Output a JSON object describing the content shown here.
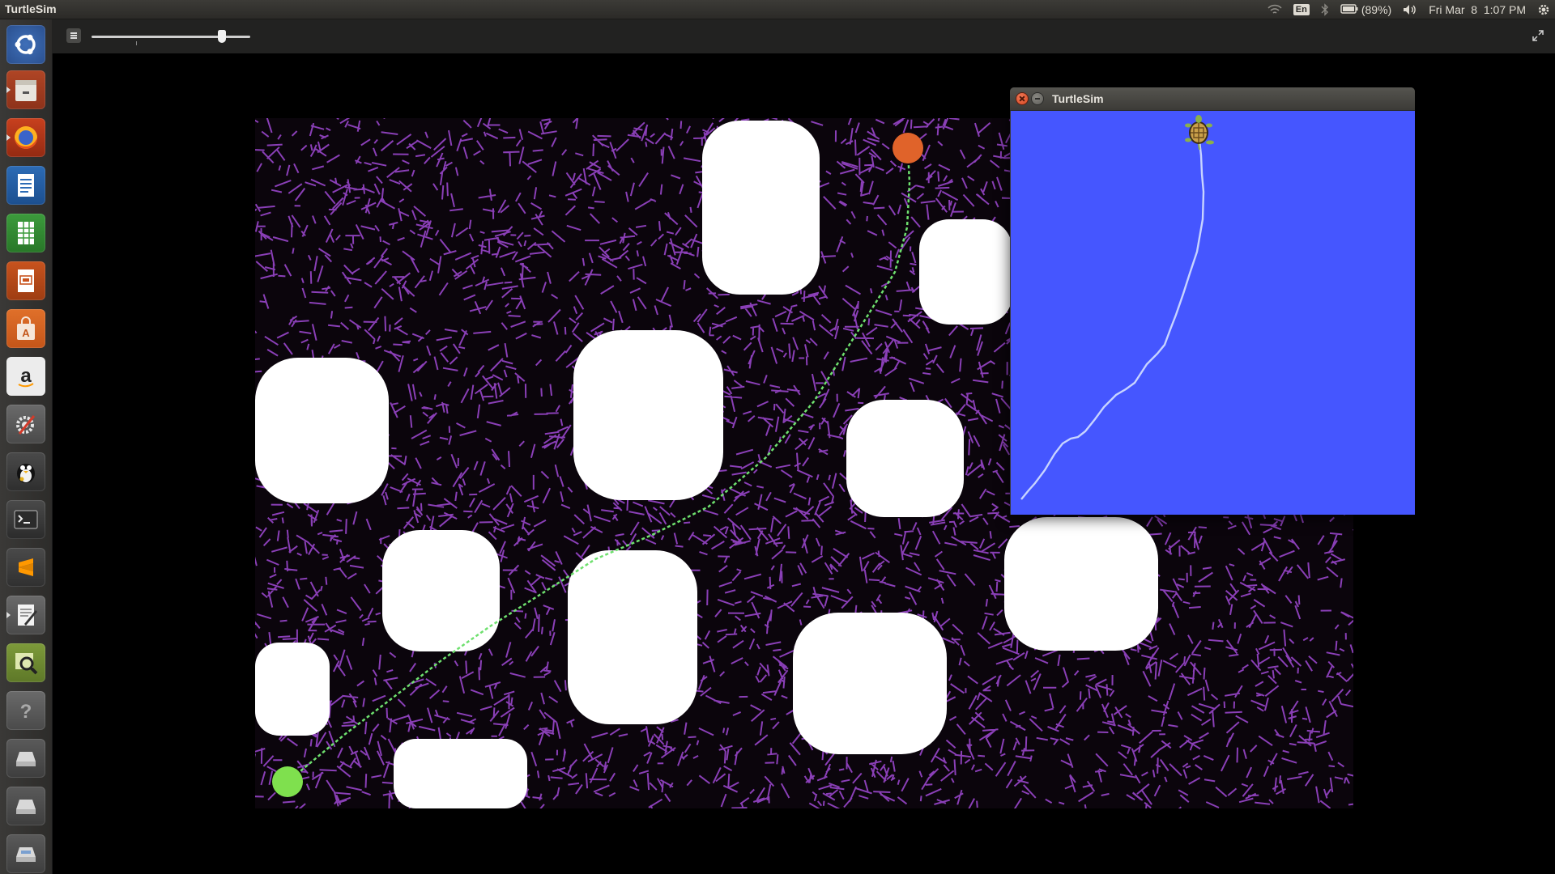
{
  "top_panel": {
    "app_title": "TurtleSim",
    "language": "En",
    "battery": "(89%)",
    "datetime": "Fri Mar  8  1:07 PM"
  },
  "launcher": {
    "items": [
      {
        "name": "dash",
        "icon": "ubuntu-logo-icon"
      },
      {
        "name": "files",
        "icon": "file-cabinet-icon"
      },
      {
        "name": "firefox",
        "icon": "firefox-icon"
      },
      {
        "name": "writer",
        "icon": "document-icon"
      },
      {
        "name": "calc",
        "icon": "spreadsheet-icon"
      },
      {
        "name": "impress",
        "icon": "presentation-icon"
      },
      {
        "name": "software-center",
        "icon": "shopping-bag-icon"
      },
      {
        "name": "amazon",
        "icon": "amazon-icon"
      },
      {
        "name": "system-settings",
        "icon": "wrench-gear-icon"
      },
      {
        "name": "gnome-ppp",
        "icon": "penguin-icon"
      },
      {
        "name": "terminal",
        "icon": "terminal-icon"
      },
      {
        "name": "sublime-text",
        "icon": "sublime-icon"
      },
      {
        "name": "text-editor",
        "icon": "text-editor-icon"
      },
      {
        "name": "image-viewer",
        "icon": "magnifier-icon"
      },
      {
        "name": "help",
        "icon": "help-icon"
      },
      {
        "name": "drive-1",
        "icon": "drive-icon"
      },
      {
        "name": "drive-2",
        "icon": "drive-icon"
      },
      {
        "name": "drive-3",
        "icon": "drive-icon"
      }
    ]
  },
  "video_toolbar": {
    "playback_position": 0.82
  },
  "turtlesim_window": {
    "title": "TurtleSim",
    "background_color": "#4556ff",
    "path_color": "#c8d4ff"
  },
  "map": {
    "background_color": "#0b050c",
    "branch_color": "#a14ad6",
    "obstacle_color": "#ffffff",
    "path_color": "#6ee06e",
    "start_color": "#7fe04e",
    "goal_color": "#e0632a"
  }
}
